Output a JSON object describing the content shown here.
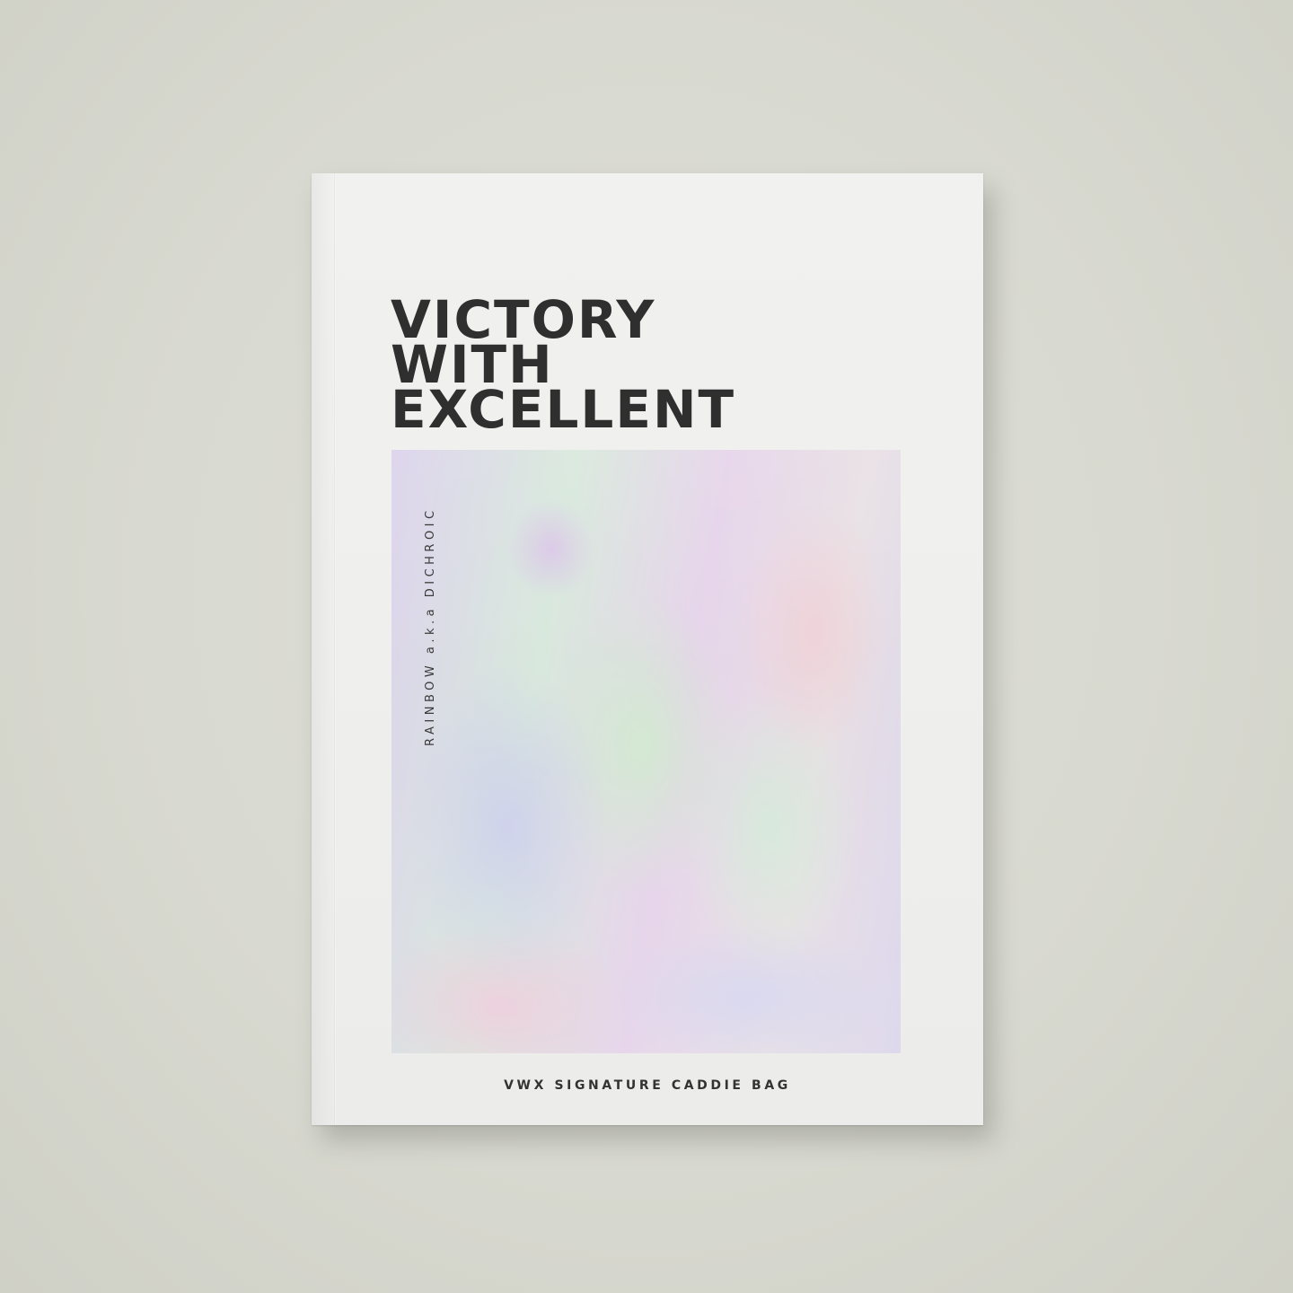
{
  "cover": {
    "title_lines": [
      "VICTORY",
      "WITH",
      "EXCELLENT"
    ],
    "vertical_label": "RAINBOW a.k.a DICHROIC",
    "footer_label": "VWX SIGNATURE CADDIE BAG"
  },
  "colors": {
    "background": "#d8d9d0",
    "cover": "#efefed",
    "title_text": "#2f2f2f"
  }
}
